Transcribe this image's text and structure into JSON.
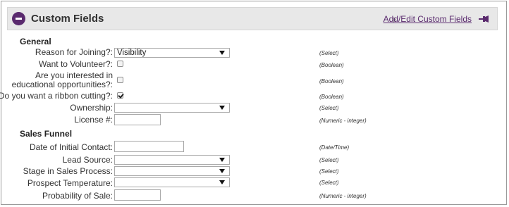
{
  "panel": {
    "title": "Custom Fields",
    "add_edit_link": "Add/Edit Custom Fields",
    "accent_color": "#5a2a6e"
  },
  "sections": {
    "general": {
      "title": "General",
      "fields": {
        "reason": {
          "label": "Reason for Joining?:",
          "value": "Visibility",
          "type": "(Select)"
        },
        "volunteer": {
          "label": "Want to Volunteer?:",
          "checked": false,
          "type": "(Boolean)"
        },
        "education": {
          "label": "Are you interested in educational opportunities?:",
          "checked": false,
          "type": "(Boolean)"
        },
        "ribbon": {
          "label": "Do you want a ribbon cutting?:",
          "checked": true,
          "type": "(Boolean)"
        },
        "ownership": {
          "label": "Ownership:",
          "value": "",
          "type": "(Select)"
        },
        "license": {
          "label": "License #:",
          "value": "",
          "type": "(Numeric - integer)"
        }
      }
    },
    "sales_funnel": {
      "title": "Sales Funnel",
      "fields": {
        "initial_contact": {
          "label": "Date of Initial Contact:",
          "value": "",
          "type": "(Date/Time)"
        },
        "lead_source": {
          "label": "Lead Source:",
          "value": "",
          "type": "(Select)"
        },
        "stage": {
          "label": "Stage in Sales Process:",
          "value": "",
          "type": "(Select)"
        },
        "temperature": {
          "label": "Prospect Temperature:",
          "value": "",
          "type": "(Select)"
        },
        "probability": {
          "label": "Probability of Sale:",
          "value": "",
          "type": "(Numeric - integer)"
        }
      }
    }
  }
}
